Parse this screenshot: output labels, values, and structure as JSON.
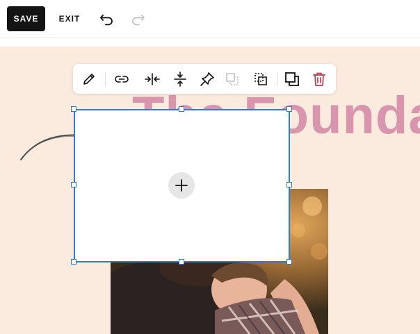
{
  "topbar": {
    "save_label": "SAVE",
    "exit_label": "EXIT",
    "undo_icon": "undo-icon",
    "redo_icon": "redo-icon",
    "redo_enabled": false
  },
  "canvas": {
    "heading": "The Founda",
    "heading_color": "#d895ad",
    "background_color": "#fbebdf"
  },
  "toolbar": {
    "buttons": [
      {
        "icon": "pencil-icon",
        "enabled": true
      },
      {
        "icon": "link-icon",
        "enabled": true
      },
      {
        "icon": "shrink-horizontal-icon",
        "enabled": true
      },
      {
        "icon": "shrink-vertical-icon",
        "enabled": true
      },
      {
        "icon": "pin-icon",
        "enabled": true
      },
      {
        "icon": "bring-forward-icon",
        "enabled": false
      },
      {
        "icon": "send-backward-icon",
        "enabled": true
      },
      {
        "icon": "duplicate-icon",
        "enabled": true
      },
      {
        "icon": "trash-icon",
        "enabled": true
      }
    ]
  },
  "block": {
    "selection_color": "#2a7dd1",
    "add_icon": "plus-icon"
  },
  "colors": {
    "accent_dark": "#141414",
    "delete_red": "#c0394b",
    "disabled": "#c4c4c4"
  }
}
